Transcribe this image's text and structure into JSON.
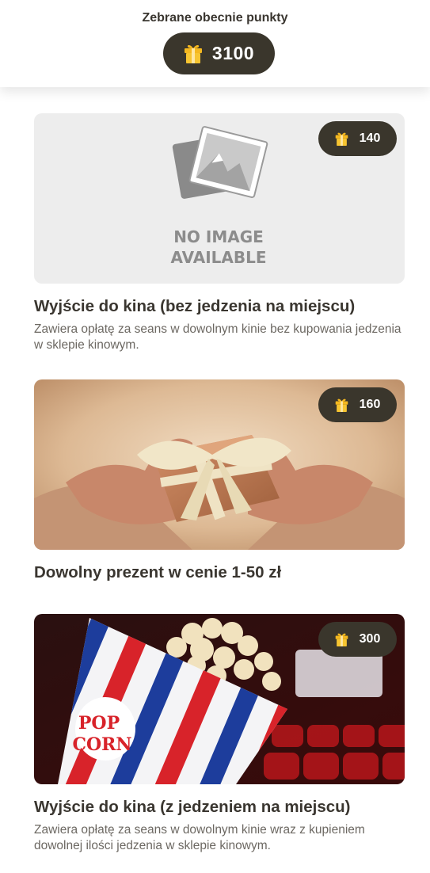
{
  "header": {
    "title": "Zebrane obecnie punkty",
    "points": "3100"
  },
  "colors": {
    "pill_background": "#3a362c",
    "text_primary": "#3a3630",
    "text_secondary": "#6c6862",
    "gift_icon": "#f5b81f"
  },
  "rewards": [
    {
      "cost": "140",
      "title": "Wyjście do kina (bez jedzenia na miejscu)",
      "description": "Zawiera opłatę za seans w dowolnym kinie bez kupowania jedzenia w sklepie kinowym.",
      "image": "no-image-placeholder",
      "image_text_line1": "NO IMAGE",
      "image_text_line2": "AVAILABLE"
    },
    {
      "cost": "160",
      "title": "Dowolny prezent w cenie 1-50 zł",
      "description": "",
      "image": "gift-box-in-hands-photo"
    },
    {
      "cost": "300",
      "title": "Wyjście do kina (z jedzeniem na miejscu)",
      "description": "Zawiera opłatę za seans w dowolnym kinie wraz z kupieniem dowolnej ilości jedzenia w sklepie kinowym.",
      "image": "popcorn-cinema-photo",
      "image_text_line1": "POP",
      "image_text_line2": "CORN"
    }
  ]
}
